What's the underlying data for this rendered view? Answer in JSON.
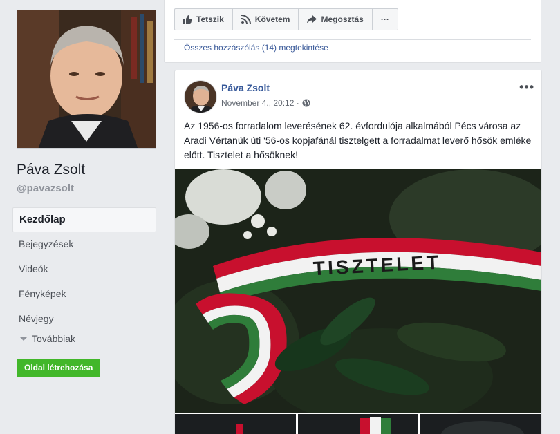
{
  "sidebar": {
    "page_name": "Páva Zsolt",
    "handle": "@pavazsolt",
    "nav": [
      {
        "label": "Kezdőlap",
        "active": true
      },
      {
        "label": "Bejegyzések"
      },
      {
        "label": "Videók"
      },
      {
        "label": "Fényképek"
      },
      {
        "label": "Névjegy"
      }
    ],
    "more_label": "Továbbiak",
    "create_button": "Oldal létrehozása"
  },
  "prev_post": {
    "actions": [
      {
        "label": "Tetszik",
        "icon": "thumbs-up-icon"
      },
      {
        "label": "Követem",
        "icon": "rss-icon"
      },
      {
        "label": "Megosztás",
        "icon": "share-arrow-icon"
      },
      {
        "label": "···",
        "icon": "more-icon"
      }
    ],
    "all_comments": "Összes hozzászólás (14) megtekintése"
  },
  "post": {
    "author": "Páva Zsolt",
    "date": "November 4., 20:12 ·",
    "privacy_icon": "globe-icon",
    "menu": "•••",
    "text": "Az 1956-os forradalom leverésének 62. évfordulója alkalmából Pécs városa az Aradi Vértanúk úti '56-os kopjafánál tisztelgett a forradalmat leverő hősök emléke előtt. Tisztelet a hősöknek!",
    "ribbon_text": "TISZTELET"
  },
  "colors": {
    "link": "#385898",
    "author": "#365899",
    "green_button": "#42b72a",
    "flag_red": "#c8102e",
    "flag_green": "#2f7d3a"
  }
}
